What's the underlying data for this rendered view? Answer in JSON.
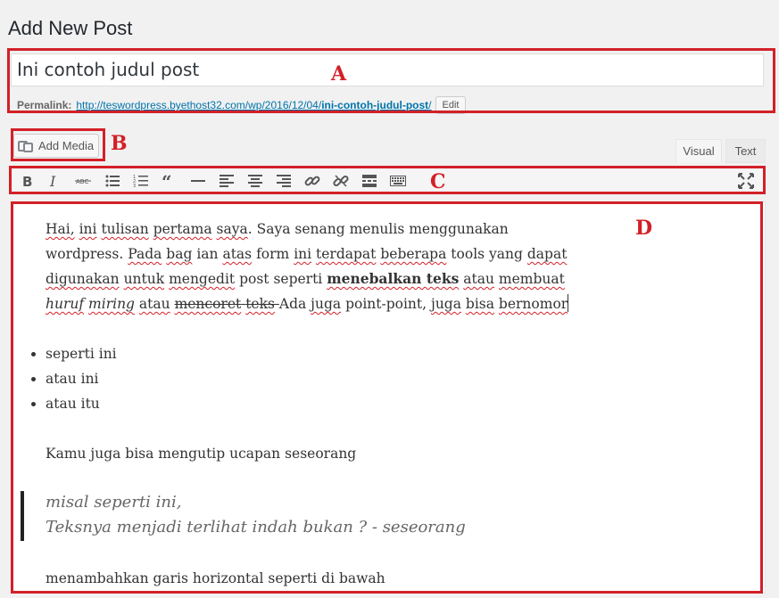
{
  "page": {
    "title": "Add New Post"
  },
  "post": {
    "title_value": "Ini contoh judul post",
    "permalink_label": "Permalink:",
    "permalink_base": "http://teswordpress.byethost32.com/wp/2016/12/04/",
    "permalink_slug": "ini-contoh-judul-post",
    "permalink_end": "/",
    "edit_label": "Edit"
  },
  "media": {
    "add_media_label": "Add Media"
  },
  "tabs": {
    "visual": "Visual",
    "text": "Text"
  },
  "toolbar": {
    "icons": [
      "bold-icon",
      "italic-icon",
      "strikethrough-icon",
      "bulleted-list-icon",
      "numbered-list-icon",
      "blockquote-icon",
      "horizontal-line-icon",
      "align-left-icon",
      "align-center-icon",
      "align-right-icon",
      "link-icon",
      "unlink-icon",
      "read-more-icon",
      "toolbar-toggle-icon",
      "fullscreen-icon"
    ]
  },
  "annotations": {
    "a": "A",
    "b": "B",
    "c": "C",
    "d": "D"
  },
  "annotation_color": "#d32027",
  "content": {
    "p1": {
      "w1": "Hai,",
      "w2": "ini",
      "w3": "tulisan",
      "w4": "pertama",
      "w5": "saya",
      "t1": ". Saya senang menulis menggunakan",
      "t2": "wordpress.",
      "w6": "Pada",
      "w7": "bag",
      "t3": "ian",
      "w8": "atas",
      "t4": "form",
      "w9": "ini",
      "w10": "terdapat",
      "w11": "beberapa",
      "t5": "tools yang",
      "w12": "dapat",
      "w13": "digunakan",
      "w14": "untuk",
      "w15": "mengedit",
      "t6": "post  seperti",
      "w16": "menebalkan teks",
      "w17": "atau",
      "w18": "membuat",
      "w19": "huruf",
      "w20": "miring",
      "w21": "atau",
      "w22": "mencoret",
      "w23": "teks",
      "t7": "Ada",
      "w24": "juga",
      "t8": "point-point,",
      "w25": "juga",
      "w26": "bisa",
      "w27": "bernomor"
    },
    "bullets": [
      "seperti ini",
      "atau ini",
      "atau itu"
    ],
    "p2": "Kamu juga bisa mengutip ucapan seseorang",
    "quote": [
      "misal seperti ini,",
      "Teksnya menjadi terlihat indah bukan ? - seseorang"
    ],
    "p3": "menambahkan garis horizontal seperti di bawah"
  }
}
